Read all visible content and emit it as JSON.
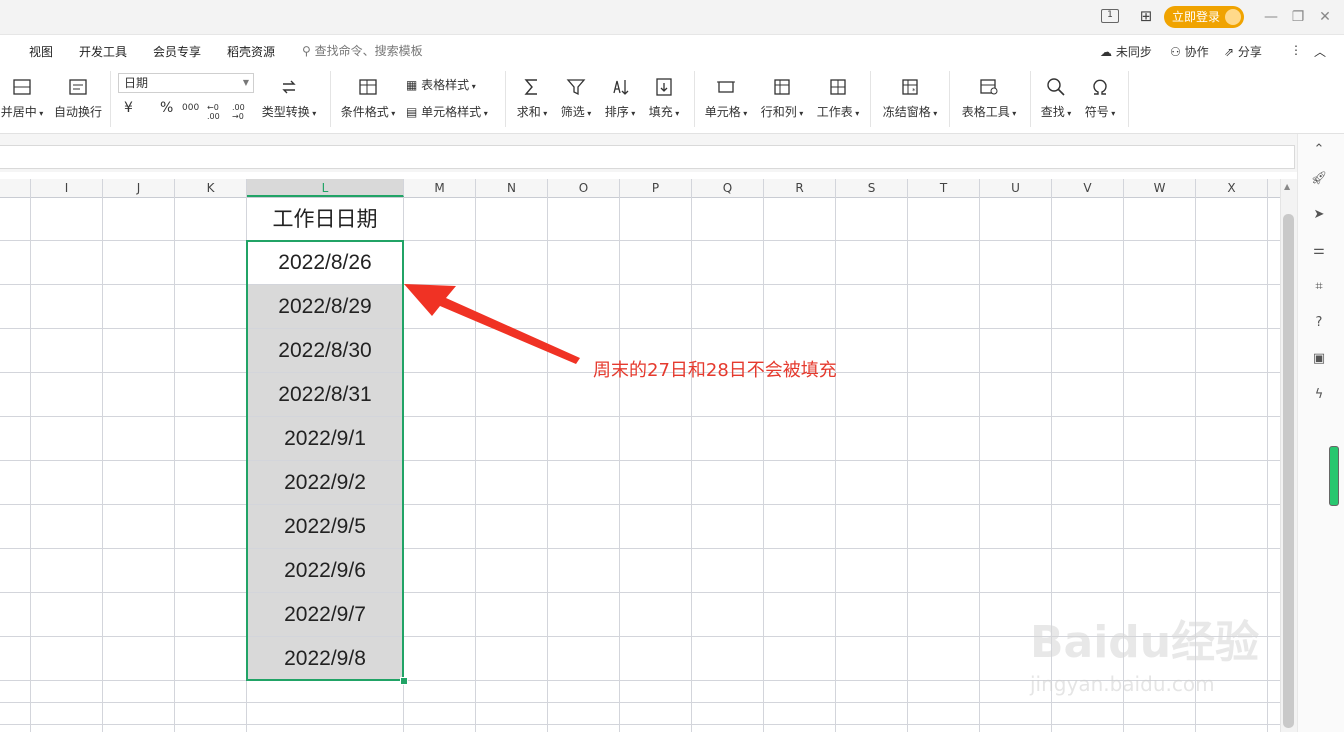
{
  "titlebar": {
    "login_label": "立即登录"
  },
  "menu": {
    "tabs": [
      "视图",
      "开发工具",
      "会员专享",
      "稻壳资源"
    ],
    "search_placeholder": "查找命令、搜索模板",
    "right_actions": [
      "未同步",
      "协作",
      "分享"
    ]
  },
  "ribbon": {
    "merge_label": "并居中",
    "wrap_label": "自动换行",
    "format_value": "日期",
    "currency_symbol": "¥",
    "percent_symbol": "%",
    "thousands_symbol": "000",
    "inc_decimal": "←0 .00",
    "dec_decimal": ".00 →0",
    "type_convert": "类型转换",
    "cond_format": "条件格式",
    "table_style": "表格样式",
    "cell_style": "单元格样式",
    "sum": "求和",
    "filter": "筛选",
    "sort": "排序",
    "fill": "填充",
    "cell": "单元格",
    "row_col": "行和列",
    "worksheet": "工作表",
    "freeze": "冻结窗格",
    "table_tools": "表格工具",
    "find": "查找",
    "symbol": "符号"
  },
  "columns": [
    "I",
    "J",
    "K",
    "L",
    "M",
    "N",
    "O",
    "P",
    "Q",
    "R",
    "S",
    "T",
    "U",
    "V",
    "W",
    "X"
  ],
  "selected_column": "L",
  "cells": {
    "header": "工作日日期",
    "dates": [
      "2022/8/26",
      "2022/8/29",
      "2022/8/30",
      "2022/8/31",
      "2022/9/1",
      "2022/9/2",
      "2022/9/5",
      "2022/9/6",
      "2022/9/7",
      "2022/9/8"
    ]
  },
  "annotation": "周末的27日和28日不会被填充",
  "watermark": {
    "logo": "Baidu经验",
    "url": "jingyan.baidu.com"
  },
  "colors": {
    "selection": "#21a366",
    "annotation": "#e53a2e",
    "login": "#f0a300",
    "shade": "#d9d9d9"
  }
}
